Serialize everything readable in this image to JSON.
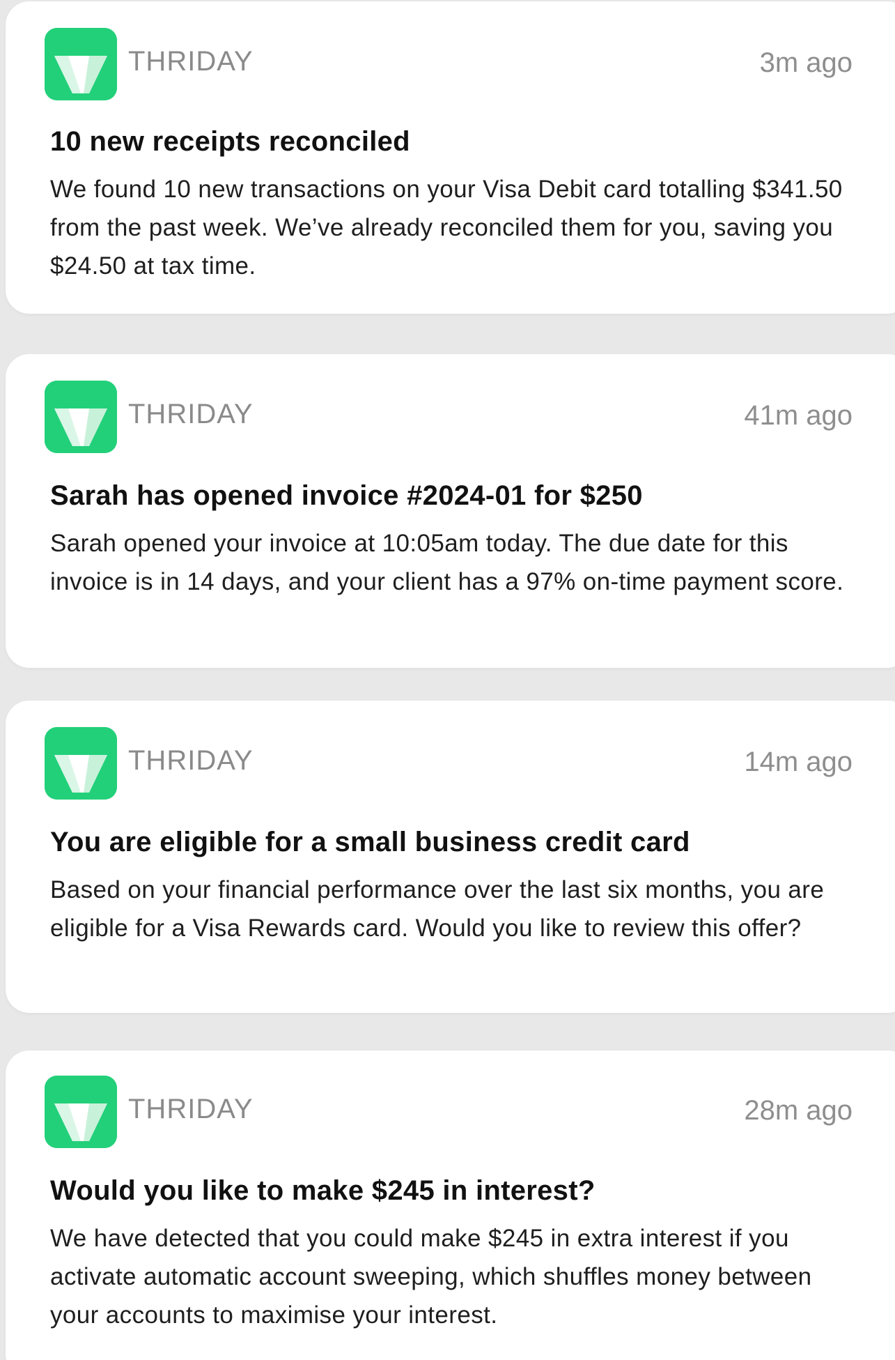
{
  "brand": {
    "accent_color": "#22d07a",
    "icon": "thriday-logo-icon"
  },
  "notifications": [
    {
      "app_name": "THRIDAY",
      "time": "3m ago",
      "title": "10 new receipts reconciled",
      "body": "We found 10 new transactions on your Visa Debit card totalling $341.50 from the past week. We’ve already reconciled them for you, saving you $24.50 at tax time."
    },
    {
      "app_name": "THRIDAY",
      "time": "41m ago",
      "title": "Sarah has opened invoice #2024-01 for $250",
      "body": "Sarah opened your invoice at 10:05am today. The due date for this invoice is in 14 days, and your client has a 97% on-time payment score."
    },
    {
      "app_name": "THRIDAY",
      "time": "14m ago",
      "title": "You are eligible for a small business credit card",
      "body": "Based on your financial performance over the last six months, you are eligible for a Visa Rewards card. Would you like to review this offer?"
    },
    {
      "app_name": "THRIDAY",
      "time": "28m ago",
      "title": "Would you like to make $245 in interest?",
      "body": "We have detected that you could make $245 in extra interest if you activate automatic account sweeping, which shuffles money between your accounts to maximise your interest."
    }
  ]
}
